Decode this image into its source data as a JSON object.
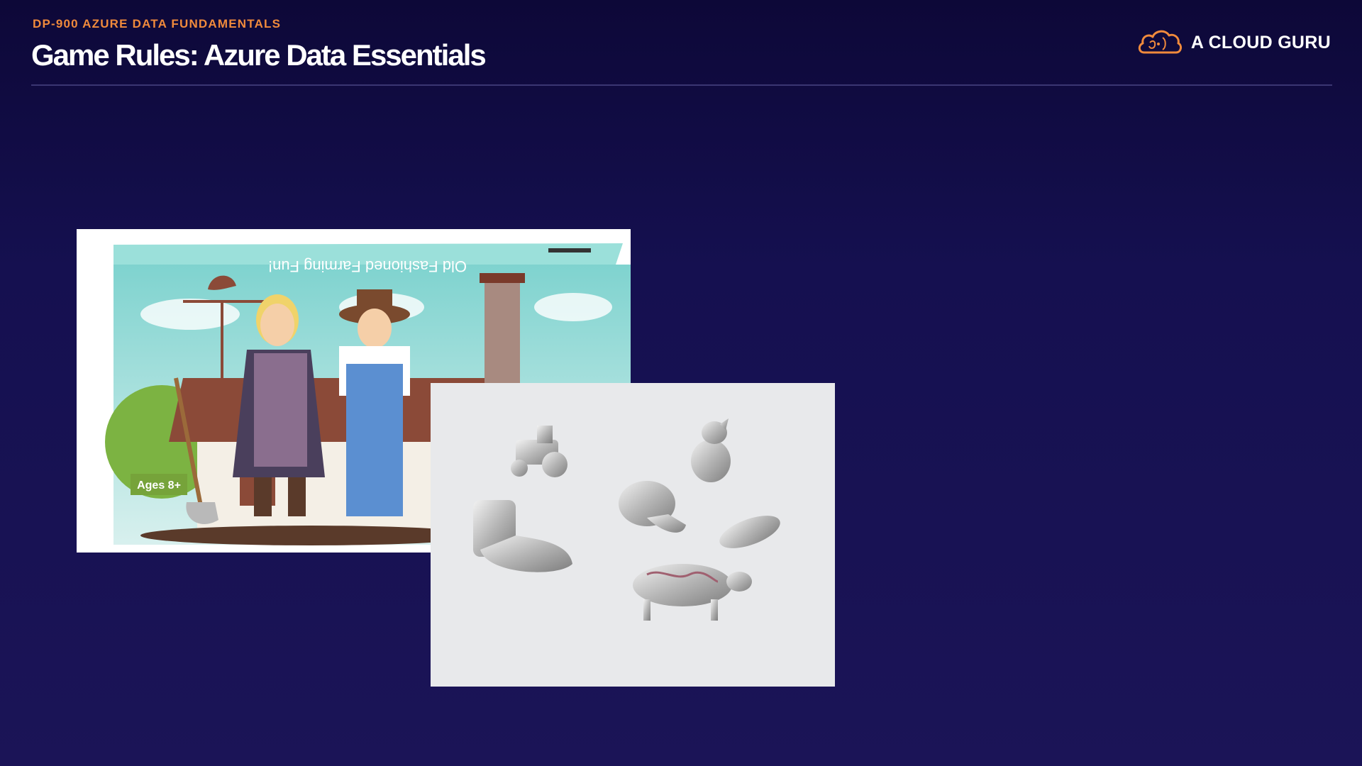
{
  "slide": {
    "eyebrow": "DP-900 AZURE DATA FUNDAMENTALS",
    "title": "Game Rules: Azure Data Essentials"
  },
  "brand": {
    "name": "A CLOUD GURU",
    "icon": "cloud-logo-icon",
    "accent": "#f08a3c"
  },
  "images": {
    "game_box": {
      "box_banner": "Old Fashioned Farming Fun!",
      "age_badge": "Ages 8+"
    },
    "tokens": {
      "icon": "pewter-game-tokens"
    }
  },
  "colors": {
    "background": "#151050",
    "eyebrow": "#f08a3c",
    "title": "#ffffff"
  }
}
